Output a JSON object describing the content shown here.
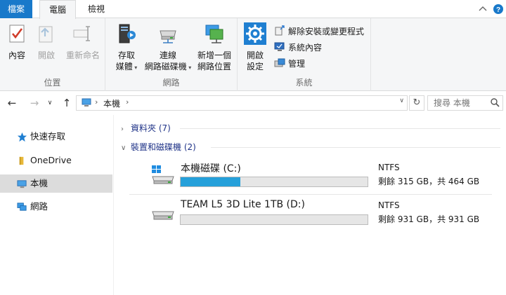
{
  "tabs": {
    "file": "檔案",
    "computer": "電腦",
    "view": "檢視"
  },
  "ribbon": {
    "location": {
      "label": "位置",
      "properties": "內容",
      "open": "開啟",
      "rename": "重新命名"
    },
    "network": {
      "label": "網路",
      "access_media_1": "存取",
      "access_media_2": "媒體",
      "map_drive_1": "連線",
      "map_drive_2": "網路磁碟機",
      "add_location_1": "新增一個",
      "add_location_2": "網路位置"
    },
    "system": {
      "label": "系統",
      "open_settings_1": "開啟",
      "open_settings_2": "設定",
      "uninstall": "解除安裝或變更程式",
      "system_properties": "系統內容",
      "manage": "管理"
    }
  },
  "navigation": {
    "address": "本機",
    "search_placeholder": "搜尋 本機"
  },
  "sidebar": {
    "items": [
      {
        "label": "快速存取"
      },
      {
        "label": "OneDrive"
      },
      {
        "label": "本機"
      },
      {
        "label": "網路"
      }
    ]
  },
  "content": {
    "folders_section": "資料夾 (7)",
    "devices_section": "裝置和磁碟機 (2)",
    "drives": [
      {
        "name": "本機磁碟 (C:)",
        "filesystem": "NTFS",
        "free_text": "剩餘 315 GB，共 464 GB",
        "used_fraction": 0.321
      },
      {
        "name": "TEAM  L5 3D Lite 1TB (D:)",
        "filesystem": "NTFS",
        "free_text": "剩餘 931 GB，共 931 GB",
        "used_fraction": 0.0
      }
    ]
  },
  "colors": {
    "accent": "#1979ca",
    "progress_fill": "#26a0da",
    "selected_item": "#dcdcdc"
  }
}
